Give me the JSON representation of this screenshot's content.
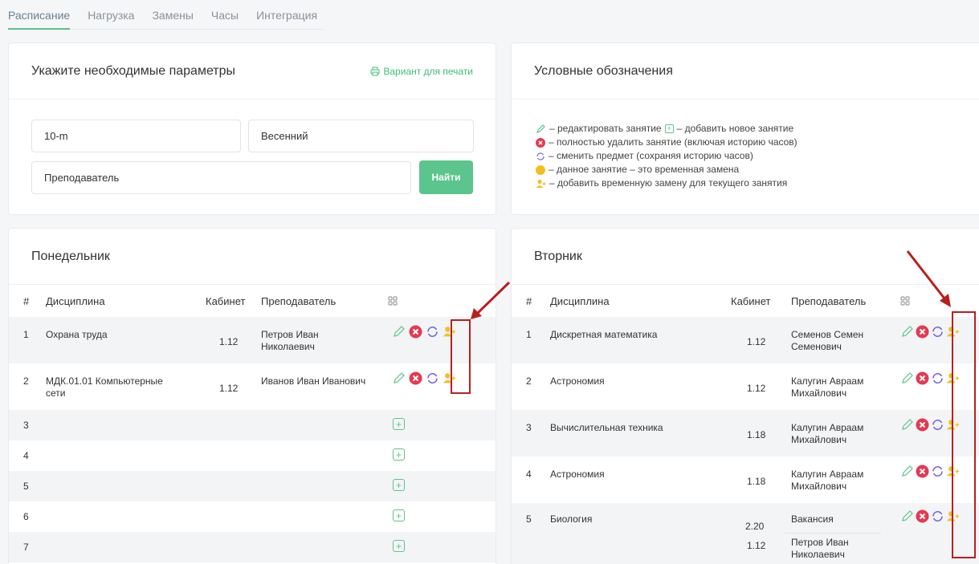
{
  "tabs": [
    "Расписание",
    "Нагрузка",
    "Замены",
    "Часы",
    "Интеграция"
  ],
  "params": {
    "title": "Укажите необходимые параметры",
    "print_label": "Вариант для печати",
    "group_value": "10-m",
    "semester_value": "Весенний",
    "teacher_value": "Преподаватель",
    "find_label": "Найти"
  },
  "legend": {
    "title": "Условные обозначения",
    "edit_text": " – редактировать занятие ",
    "add_text": " – добавить новое занятие",
    "delete_text": " – полностью удалить занятие (включая историю часов)",
    "replace_text": " – сменить предмет (сохраняя историю часов)",
    "temp_text": " – данное занятие – это временная замена",
    "add_temp_text": " – добавить временную замену для текущего занятия"
  },
  "columns": {
    "num": "#",
    "discipline": "Дисциплина",
    "room": "Кабинет",
    "teacher": "Преподаватель"
  },
  "monday": {
    "title": "Понедельник",
    "rows": [
      {
        "num": "1",
        "discipline": "Охрана труда",
        "room": "1.12",
        "teacher": "Петров Иван Николаевич"
      },
      {
        "num": "2",
        "discipline": "МДК.01.01 Компьютерные сети",
        "room": "1.12",
        "teacher": "Иванов Иван Иванович"
      },
      {
        "num": "3"
      },
      {
        "num": "4"
      },
      {
        "num": "5"
      },
      {
        "num": "6"
      },
      {
        "num": "7"
      }
    ]
  },
  "tuesday": {
    "title": "Вторник",
    "rows": [
      {
        "num": "1",
        "discipline": "Дискретная математика",
        "room": "1.12",
        "teacher": "Семенов Семен Семенович"
      },
      {
        "num": "2",
        "discipline": "Астрономия",
        "room": "1.12",
        "teacher": "Калугин Авраам Михайлович"
      },
      {
        "num": "3",
        "discipline": "Вычислительная техника",
        "room": "1.18",
        "teacher": "Калугин Авраам Михайлович"
      },
      {
        "num": "4",
        "discipline": "Астрономия",
        "room": "1.18",
        "teacher": "Калугин Авраам Михайлович"
      },
      {
        "num": "5",
        "discipline": "Биология",
        "room": "2.20",
        "teacher": "Вакансия",
        "room2": "1.12",
        "teacher2": "Петров Иван Николаевич"
      }
    ]
  },
  "icon_names": [
    "pencil-icon",
    "delete-x-icon",
    "swap-icon",
    "add-person-icon",
    "plus-box-icon",
    "grid-icon",
    "printer-icon",
    "yellow-dot-icon"
  ],
  "colors": {
    "accent": "#5cc48d",
    "delete": "#e53950",
    "swap": "#6a5fe0",
    "temp": "#f5bd1f",
    "annotation": "#b81f1f"
  }
}
